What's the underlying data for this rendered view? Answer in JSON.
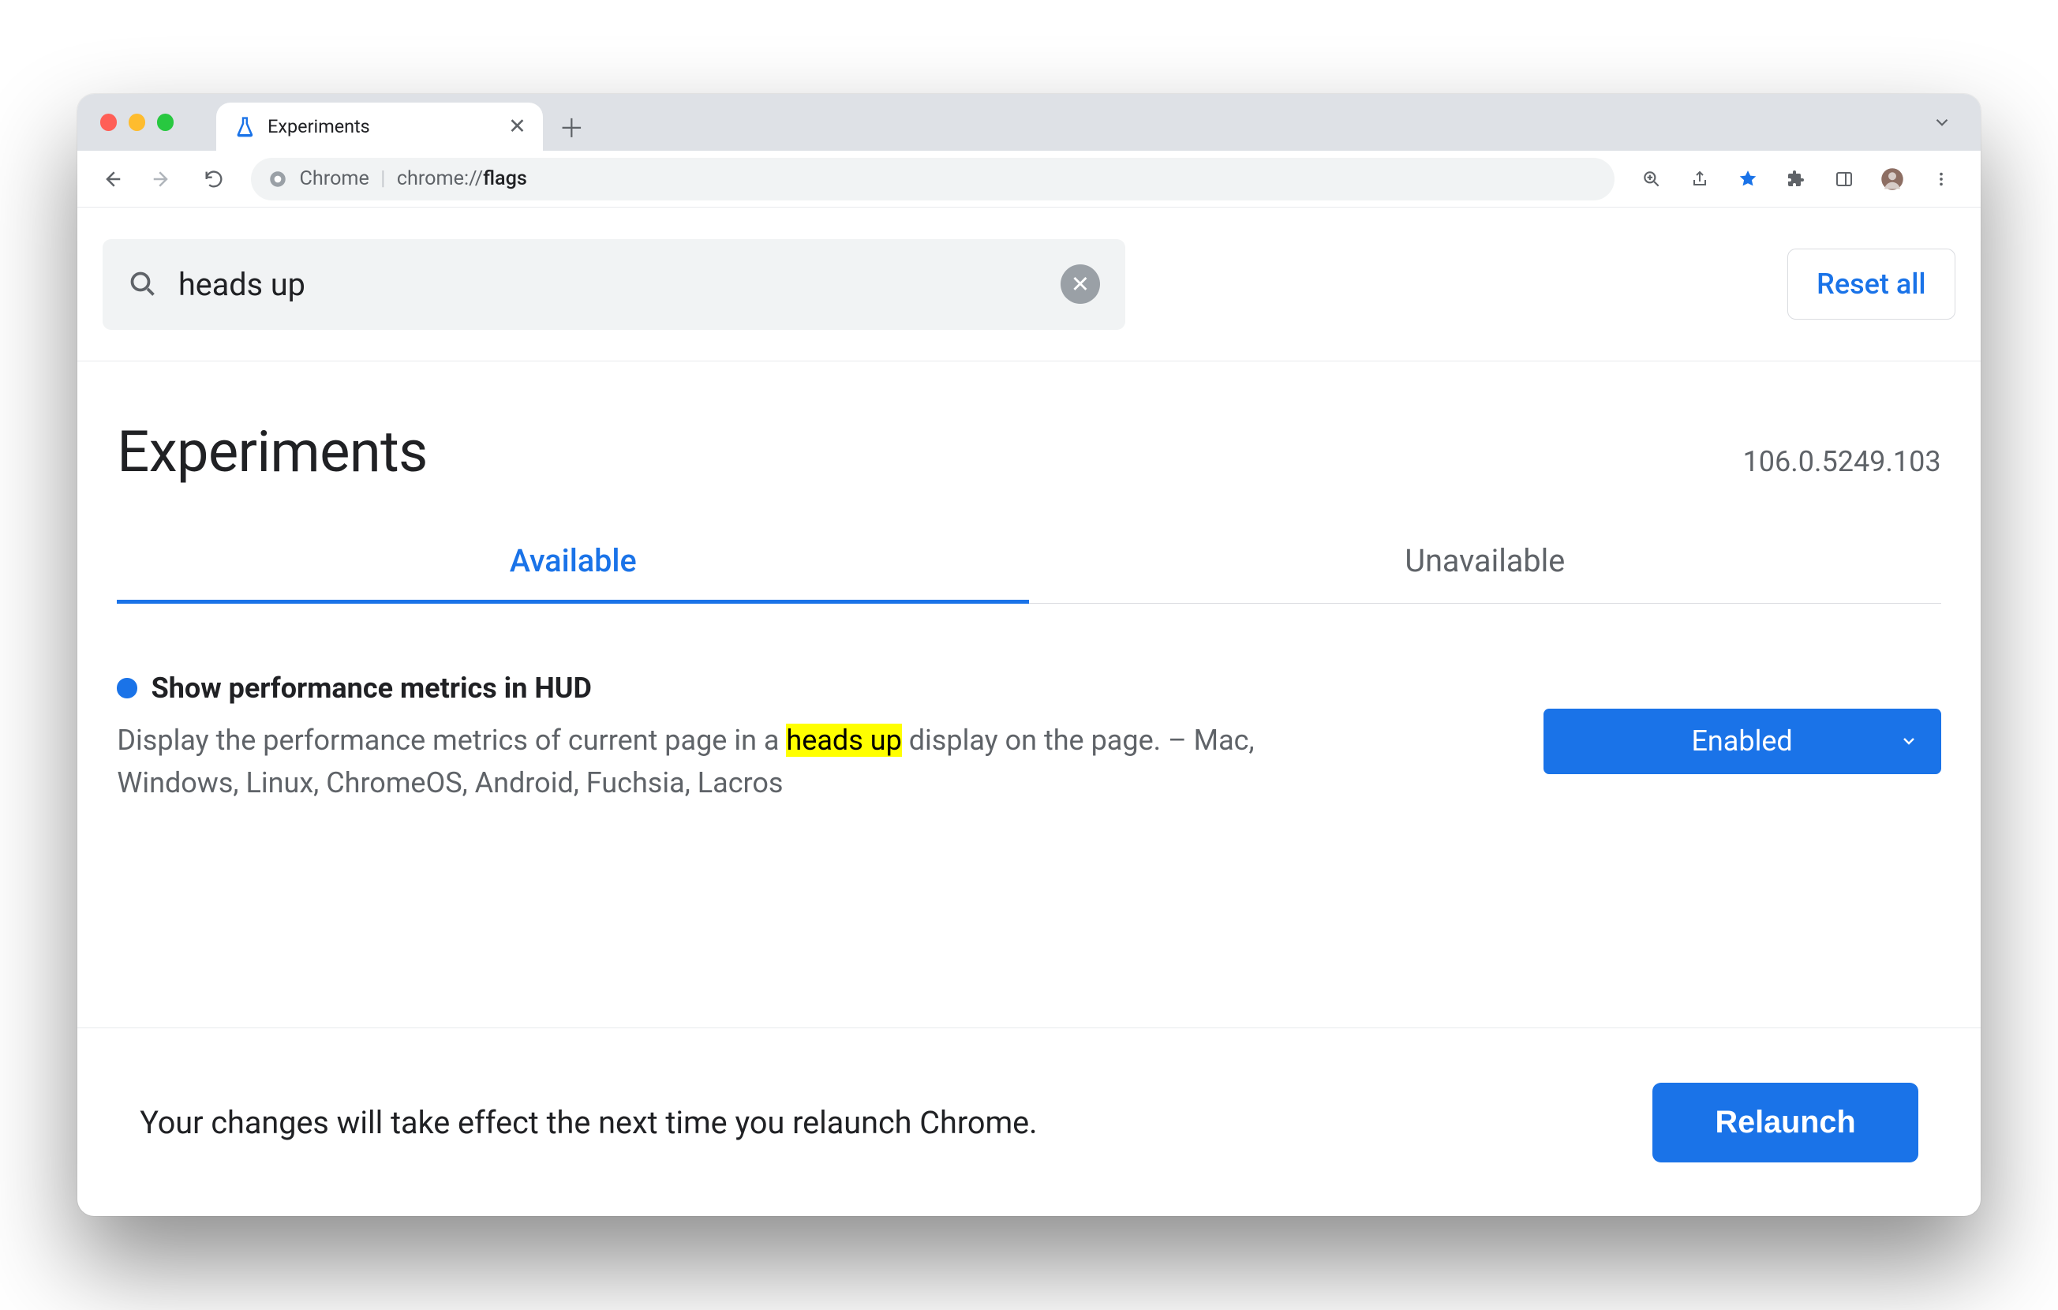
{
  "browser": {
    "tab_title": "Experiments",
    "url_prefix": "Chrome",
    "url_scheme": "chrome://",
    "url_path": "flags"
  },
  "search": {
    "value": "heads up"
  },
  "actions": {
    "reset_all": "Reset all",
    "relaunch": "Relaunch"
  },
  "page": {
    "title": "Experiments",
    "version": "106.0.5249.103"
  },
  "tabs": {
    "available": "Available",
    "unavailable": "Unavailable"
  },
  "flag": {
    "title": "Show performance metrics in HUD",
    "desc_pre": "Display the performance metrics of current page in a ",
    "desc_hl": "heads up",
    "desc_post": " display on the page. – Mac, Windows, Linux, ChromeOS, Android, Fuchsia, Lacros",
    "state": "Enabled"
  },
  "footer": {
    "message": "Your changes will take effect the next time you relaunch Chrome."
  }
}
